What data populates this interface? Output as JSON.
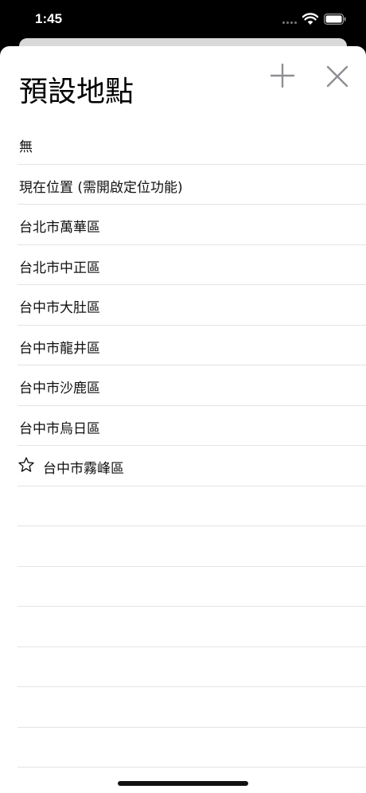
{
  "status_bar": {
    "time": "1:45"
  },
  "header": {
    "title": "預設地點",
    "add_icon": "plus-icon",
    "close_icon": "close-icon"
  },
  "locations": [
    {
      "label": "無",
      "starred": false
    },
    {
      "label": "現在位置 (需開啟定位功能)",
      "starred": false
    },
    {
      "label": "台北市萬華區",
      "starred": false
    },
    {
      "label": "台北市中正區",
      "starred": false
    },
    {
      "label": "台中市大肚區",
      "starred": false
    },
    {
      "label": "台中市龍井區",
      "starred": false
    },
    {
      "label": "台中市沙鹿區",
      "starred": false
    },
    {
      "label": "台中市烏日區",
      "starred": false
    },
    {
      "label": "台中市霧峰區",
      "starred": true
    }
  ]
}
